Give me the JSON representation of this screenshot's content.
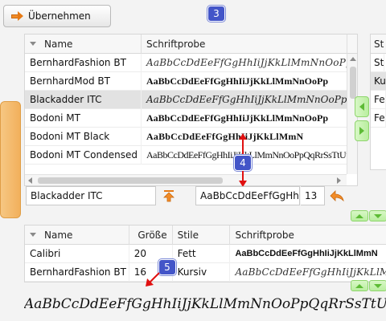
{
  "toolbar": {
    "apply_label": "Übernehmen"
  },
  "badges": {
    "b3": "3",
    "b4": "4",
    "b5": "5"
  },
  "font_table": {
    "headers": {
      "name": "Name",
      "sample": "Schriftprobe"
    },
    "rows": [
      {
        "name": "BernhardFashion BT",
        "sample": "AaBbCcDdEeFfGgHhIiJjKkLlMmNnOoPp",
        "style": "script"
      },
      {
        "name": "BernhardMod BT",
        "sample": "AaBbCcDdEeFfGgHhIiJjKkLlMmNnOoPp",
        "style": "bold"
      },
      {
        "name": "Blackadder ITC",
        "sample": "AaBbCcDdEeFfGgHhIiJjKkLlMmNnOoPpQq",
        "style": "blackadder",
        "selected": true
      },
      {
        "name": "Bodoni MT",
        "sample": "AaBbCcDdEeFfGgHhIiJjKkLlMmNnOoPp",
        "style": "bold"
      },
      {
        "name": "Bodoni MT Black",
        "sample": "AaBbCcDdEeFfGgHhIiJjKkLlMmN",
        "style": "black"
      },
      {
        "name": "Bodoni MT Condensed",
        "sample": "AaBbCcDdEeFfGgHhIiJjKkLlMmNnOoPpQqRrSsTtUuVvWwXxYyZz",
        "style": "condensed"
      }
    ]
  },
  "style_table": {
    "header": "St",
    "rows": [
      "St",
      "Kursiv",
      "Fe",
      "Fe"
    ]
  },
  "editor": {
    "font_name": "Blackadder ITC",
    "sample": "AaBbCcDdEeFfGgHhIi",
    "size": "13"
  },
  "selection_table": {
    "headers": {
      "name": "Name",
      "size": "Größe",
      "style": "Stile",
      "sample": "Schriftprobe"
    },
    "rows": [
      {
        "name": "Calibri",
        "size": "20",
        "style": "Fett",
        "sample": "AaBbCcDdEeFfGgHhIiJjKkLlMmN"
      },
      {
        "name": "BernhardFashion BT",
        "size": "16",
        "style": "Kursiv",
        "sample": "AaBbCcDdEeFfGgHhIiJjKkLlMmNnOo"
      }
    ]
  },
  "preview": {
    "text": "AaBbCcDdEeFfGgHhIiJjKkLlMmNnOoPpQqRrSsTtUuVvWwXx"
  },
  "colors": {
    "accent": "#f28c28",
    "badge": "#4355c8",
    "green": "#5dbb35",
    "red": "#e01010"
  }
}
